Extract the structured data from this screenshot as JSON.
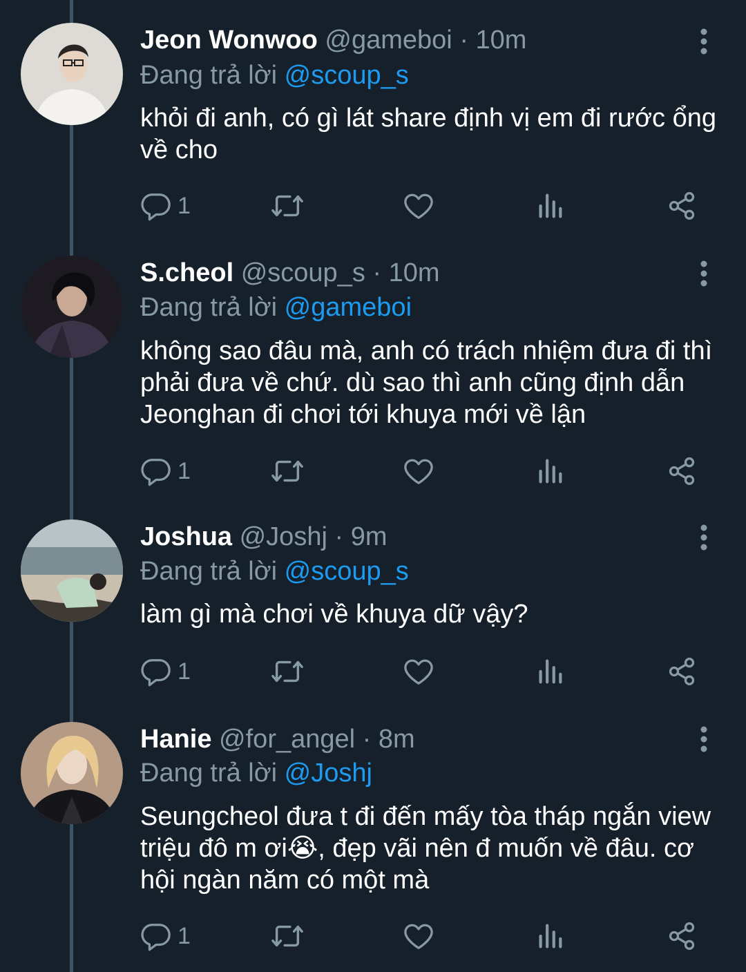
{
  "tweets": [
    {
      "name": "Jeon Wonwoo",
      "handle": "@gameboi",
      "time": "10m",
      "reply_prefix": "Đang trả lời",
      "reply_to": "@scoup_s",
      "text": "khỏi đi anh, có gì lát share định vị em đi rước ổng về cho",
      "reply_count": "1",
      "avatar_icon": "avatar-glasses-white-shirt"
    },
    {
      "name": "S.cheol",
      "handle": "@scoup_s",
      "time": "10m",
      "reply_prefix": "Đang trả lời",
      "reply_to": "@gameboi",
      "text": "không sao đâu mà, anh có trách nhiệm đưa đi thì phải đưa về chứ. dù sao thì anh cũng định dẫn Jeonghan đi chơi tới khuya mới về lận",
      "reply_count": "1",
      "avatar_icon": "avatar-dark-hair"
    },
    {
      "name": "Joshua",
      "handle": "@Joshj",
      "time": "9m",
      "reply_prefix": "Đang trả lời",
      "reply_to": "@scoup_s",
      "text": "làm gì mà chơi về khuya dữ vậy?",
      "reply_count": "1",
      "avatar_icon": "avatar-beach"
    },
    {
      "name": "Hanie",
      "handle": "@for_angel",
      "time": "8m",
      "reply_prefix": "Đang trả lời",
      "reply_to": "@Joshj",
      "text": "Seungcheol đưa t đi đến mấy tòa tháp ngắn view triệu đô m ơi😭, đẹp vãi nên đ muốn về đâu. cơ hội ngàn năm có một mà",
      "reply_count": "1",
      "avatar_icon": "avatar-blonde-hair"
    }
  ],
  "separator": "·",
  "colors": {
    "background": "#15202b",
    "secondary_text": "#8899a6",
    "link": "#1d9bf0",
    "thread_line": "#3d5466"
  },
  "icons": [
    "more-icon",
    "reply-icon",
    "retweet-icon",
    "like-icon",
    "views-icon",
    "share-icon"
  ]
}
